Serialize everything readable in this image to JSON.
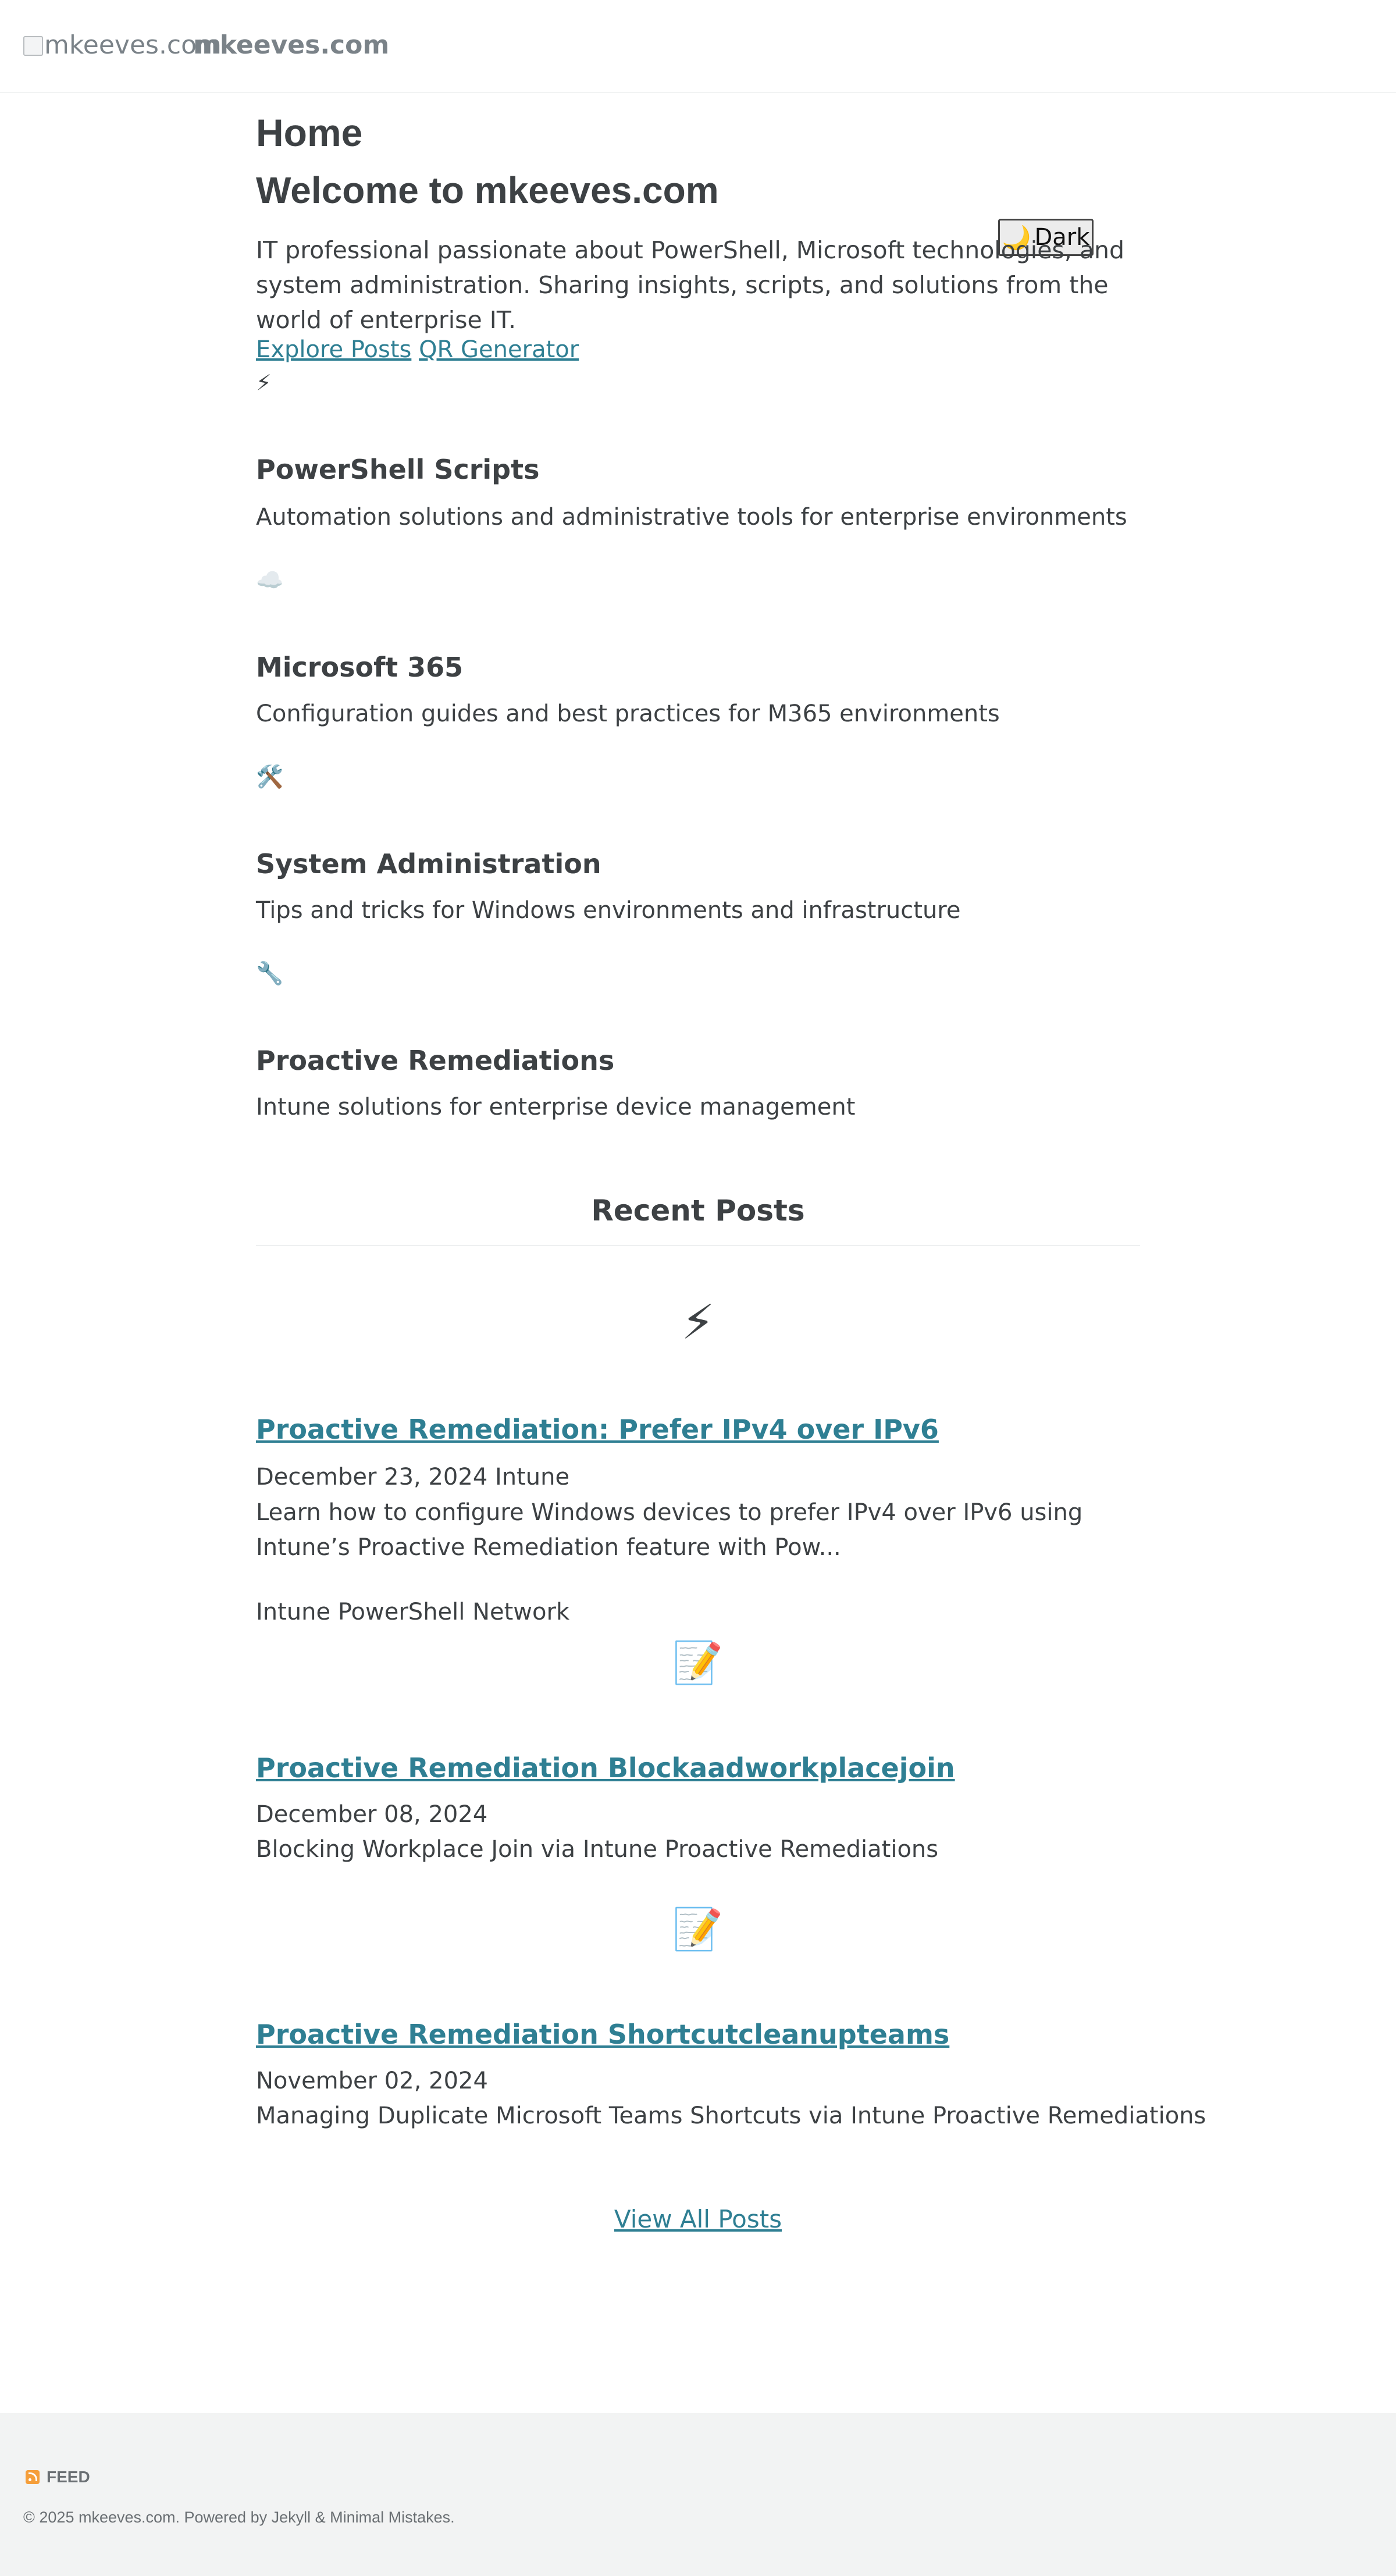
{
  "header": {
    "logo_alt": "mkeeves.com",
    "site_title": "mkeeves.com"
  },
  "page": {
    "heading": "Home",
    "welcome": "Welcome to mkeeves.com",
    "intro": "IT professional passionate about PowerShell, Microsoft technologies, and system administration. Sharing insights, scripts, and solutions from the world of enterprise IT.",
    "theme_toggle": {
      "icon": "🌙",
      "label": "Dark"
    },
    "links": [
      {
        "label": "Explore Posts"
      },
      {
        "label": "QR Generator"
      }
    ]
  },
  "categories": [
    {
      "icon": "⚡",
      "title": "PowerShell Scripts",
      "description": "Automation solutions and administrative tools for enterprise environments"
    },
    {
      "icon": "☁️",
      "title": "Microsoft 365",
      "description": "Configuration guides and best practices for M365 environments"
    },
    {
      "icon": "🛠️",
      "title": "System Administration",
      "description": "Tips and tricks for Windows environments and infrastructure"
    },
    {
      "icon": "🔧",
      "title": "Proactive Remediations",
      "description": "Intune solutions for enterprise device management"
    }
  ],
  "recent": {
    "heading": "Recent Posts",
    "posts": [
      {
        "icon": "⚡",
        "title": "Proactive Remediation: Prefer IPv4 over IPv6",
        "meta": "December 23, 2024 Intune",
        "excerpt": "Learn how to configure Windows devices to prefer IPv4 over IPv6 using Intune’s Proactive Remediation feature with Pow...",
        "tags": "Intune PowerShell Network"
      },
      {
        "icon": "📝",
        "title": "Proactive Remediation Blockaadworkplacejoin",
        "meta": "December 08, 2024",
        "excerpt": "Blocking Workplace Join via Intune Proactive Remediations"
      },
      {
        "icon": "📝",
        "title": "Proactive Remediation Shortcutcleanupteams",
        "meta": "November 02, 2024",
        "excerpt": "Managing Duplicate Microsoft Teams Shortcuts via Intune Proactive Remediations"
      }
    ],
    "view_all": "View All Posts"
  },
  "footer": {
    "feed_label": "FEED",
    "copyright": "© 2025 mkeeves.com. Powered by Jekyll & Minimal Mistakes."
  },
  "colors": {
    "link": "#2f7f93",
    "text": "#3d4144",
    "muted": "#7a8288",
    "footer_bg": "#f2f3f3",
    "rss": "#f59e3a"
  }
}
